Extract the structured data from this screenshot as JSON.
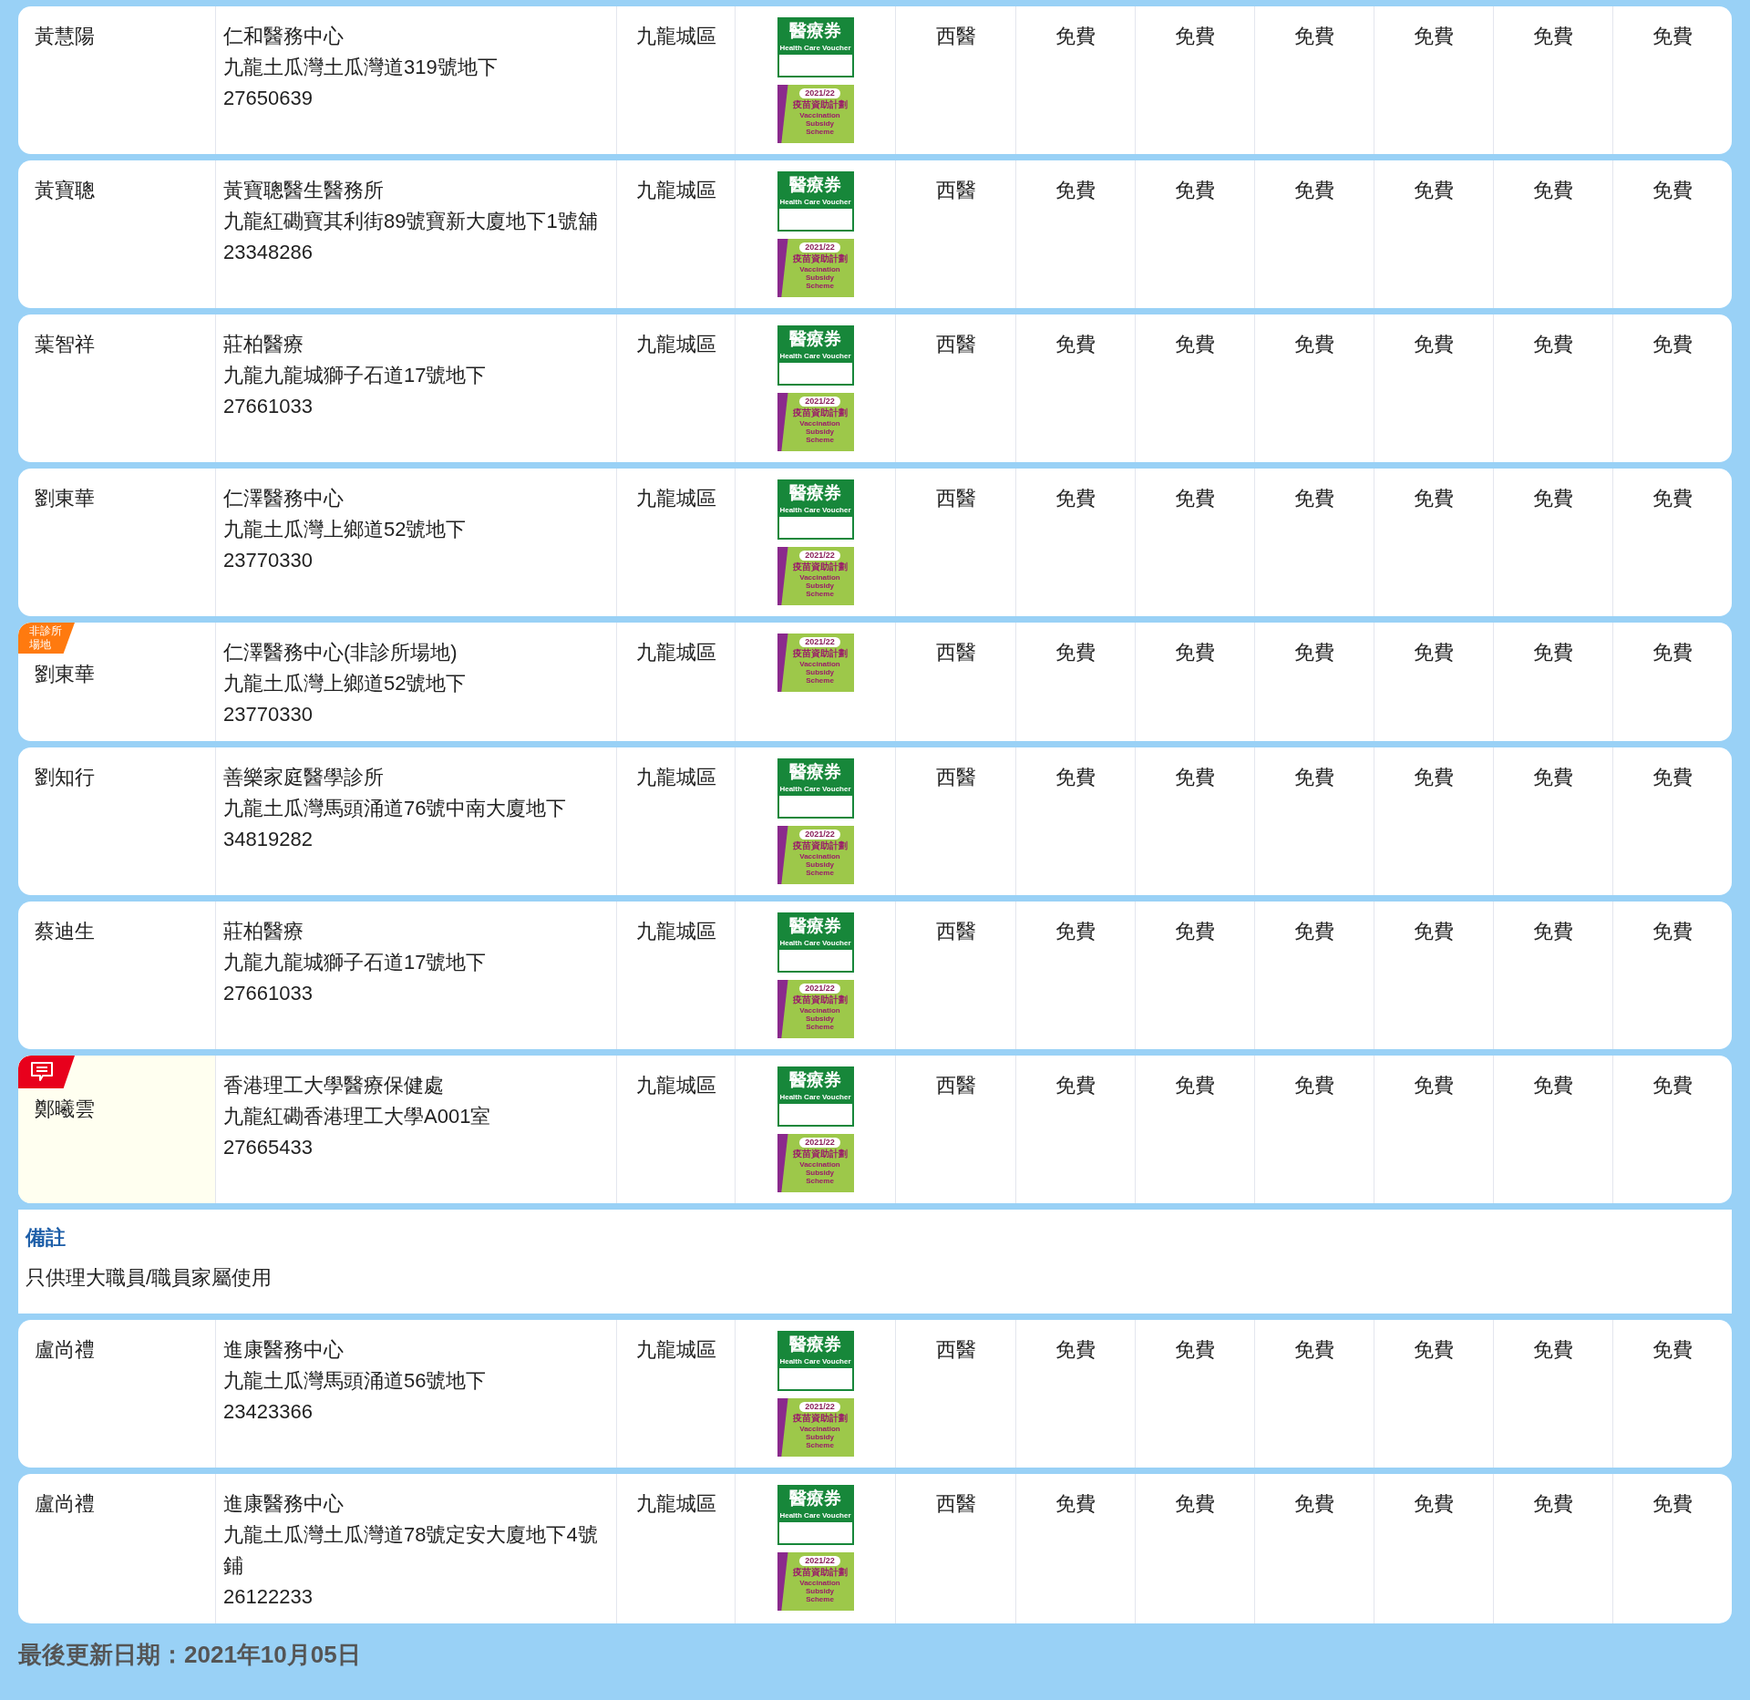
{
  "rows": [
    {
      "kind": "doctor",
      "name": "黃慧陽",
      "highlighted": false,
      "clinic": "仁和醫務中心",
      "address": "九龍土瓜灣土瓜灣道319號地下",
      "phone": "27650639",
      "district": "九龍城區",
      "badges": [
        {
          "kind": "voucher",
          "title": "醫療券",
          "subtitle": "Health Care Voucher"
        },
        {
          "kind": "vaccine",
          "year": "2021/22",
          "title": "疫苗資助計劃",
          "subtitle": "Vaccination Subsidy Scheme"
        }
      ],
      "type": "西醫",
      "fees": [
        "免費",
        "免費",
        "免費",
        "免費",
        "免費",
        "免費"
      ]
    },
    {
      "kind": "doctor",
      "name": "黃寶聰",
      "highlighted": false,
      "clinic": "黃寶聰醫生醫務所",
      "address": "九龍紅磡寶其利街89號寶新大廈地下1號舖",
      "phone": "23348286",
      "district": "九龍城區",
      "badges": [
        {
          "kind": "voucher",
          "title": "醫療券",
          "subtitle": "Health Care Voucher"
        },
        {
          "kind": "vaccine",
          "year": "2021/22",
          "title": "疫苗資助計劃",
          "subtitle": "Vaccination Subsidy Scheme"
        }
      ],
      "type": "西醫",
      "fees": [
        "免費",
        "免費",
        "免費",
        "免費",
        "免費",
        "免費"
      ]
    },
    {
      "kind": "doctor",
      "name": "葉智祥",
      "highlighted": false,
      "clinic": "莊柏醫療",
      "address": "九龍九龍城獅子石道17號地下",
      "phone": "27661033",
      "district": "九龍城區",
      "badges": [
        {
          "kind": "voucher",
          "title": "醫療券",
          "subtitle": "Health Care Voucher"
        },
        {
          "kind": "vaccine",
          "year": "2021/22",
          "title": "疫苗資助計劃",
          "subtitle": "Vaccination Subsidy Scheme"
        }
      ],
      "type": "西醫",
      "fees": [
        "免費",
        "免費",
        "免費",
        "免費",
        "免費",
        "免費"
      ]
    },
    {
      "kind": "doctor",
      "name": "劉東華",
      "highlighted": false,
      "clinic": "仁澤醫務中心",
      "address": "九龍土瓜灣上鄉道52號地下",
      "phone": "23770330",
      "district": "九龍城區",
      "badges": [
        {
          "kind": "voucher",
          "title": "醫療券",
          "subtitle": "Health Care Voucher"
        },
        {
          "kind": "vaccine",
          "year": "2021/22",
          "title": "疫苗資助計劃",
          "subtitle": "Vaccination Subsidy Scheme"
        }
      ],
      "type": "西醫",
      "fees": [
        "免費",
        "免費",
        "免費",
        "免費",
        "免費",
        "免費"
      ]
    },
    {
      "kind": "doctor",
      "name": "劉東華",
      "highlighted": false,
      "tag": {
        "kind": "non_clinic",
        "text": "非診所場地"
      },
      "clinic": "仁澤醫務中心(非診所場地)",
      "address": "九龍土瓜灣上鄉道52號地下",
      "phone": "23770330",
      "district": "九龍城區",
      "badges": [
        {
          "kind": "vaccine",
          "year": "2021/22",
          "title": "疫苗資助計劃",
          "subtitle": "Vaccination Subsidy Scheme"
        }
      ],
      "type": "西醫",
      "fees": [
        "免費",
        "免費",
        "免費",
        "免費",
        "免費",
        "免費"
      ]
    },
    {
      "kind": "doctor",
      "name": "劉知行",
      "highlighted": false,
      "clinic": "善樂家庭醫學診所",
      "address": "九龍土瓜灣馬頭涌道76號中南大廈地下",
      "phone": "34819282",
      "district": "九龍城區",
      "badges": [
        {
          "kind": "voucher",
          "title": "醫療券",
          "subtitle": "Health Care Voucher"
        },
        {
          "kind": "vaccine",
          "year": "2021/22",
          "title": "疫苗資助計劃",
          "subtitle": "Vaccination Subsidy Scheme"
        }
      ],
      "type": "西醫",
      "fees": [
        "免費",
        "免費",
        "免費",
        "免費",
        "免費",
        "免費"
      ]
    },
    {
      "kind": "doctor",
      "name": "蔡迪生",
      "highlighted": false,
      "clinic": "莊柏醫療",
      "address": "九龍九龍城獅子石道17號地下",
      "phone": "27661033",
      "district": "九龍城區",
      "badges": [
        {
          "kind": "voucher",
          "title": "醫療券",
          "subtitle": "Health Care Voucher"
        },
        {
          "kind": "vaccine",
          "year": "2021/22",
          "title": "疫苗資助計劃",
          "subtitle": "Vaccination Subsidy Scheme"
        }
      ],
      "type": "西醫",
      "fees": [
        "免費",
        "免費",
        "免費",
        "免費",
        "免費",
        "免費"
      ]
    },
    {
      "kind": "doctor",
      "name": "鄭曦雲",
      "highlighted": true,
      "tag": {
        "kind": "comment"
      },
      "clinic": "香港理工大學醫療保健處",
      "address": "九龍紅磡香港理工大學A001室",
      "phone": "27665433",
      "district": "九龍城區",
      "badges": [
        {
          "kind": "voucher",
          "title": "醫療券",
          "subtitle": "Health Care Voucher"
        },
        {
          "kind": "vaccine",
          "year": "2021/22",
          "title": "疫苗資助計劃",
          "subtitle": "Vaccination Subsidy Scheme"
        }
      ],
      "type": "西醫",
      "fees": [
        "免費",
        "免費",
        "免費",
        "免費",
        "免費",
        "免費"
      ]
    },
    {
      "kind": "remark",
      "heading": "備註",
      "text": "只供理大職員/職員家屬使用"
    },
    {
      "kind": "doctor",
      "name": "盧尚禮",
      "highlighted": false,
      "clinic": "進康醫務中心",
      "address": "九龍土瓜灣馬頭涌道56號地下",
      "phone": "23423366",
      "district": "九龍城區",
      "badges": [
        {
          "kind": "voucher",
          "title": "醫療券",
          "subtitle": "Health Care Voucher"
        },
        {
          "kind": "vaccine",
          "year": "2021/22",
          "title": "疫苗資助計劃",
          "subtitle": "Vaccination Subsidy Scheme"
        }
      ],
      "type": "西醫",
      "fees": [
        "免費",
        "免費",
        "免費",
        "免費",
        "免費",
        "免費"
      ]
    },
    {
      "kind": "doctor",
      "name": "盧尚禮",
      "highlighted": false,
      "clinic": "進康醫務中心",
      "address": "九龍土瓜灣土瓜灣道78號定安大廈地下4號鋪",
      "phone": "26122233",
      "district": "九龍城區",
      "badges": [
        {
          "kind": "voucher",
          "title": "醫療券",
          "subtitle": "Health Care Voucher"
        },
        {
          "kind": "vaccine",
          "year": "2021/22",
          "title": "疫苗資助計劃",
          "subtitle": "Vaccination Subsidy Scheme"
        }
      ],
      "type": "西醫",
      "fees": [
        "免費",
        "免費",
        "免費",
        "免費",
        "免費",
        "免費"
      ]
    }
  ],
  "footer": "最後更新日期：2021年10月05日"
}
